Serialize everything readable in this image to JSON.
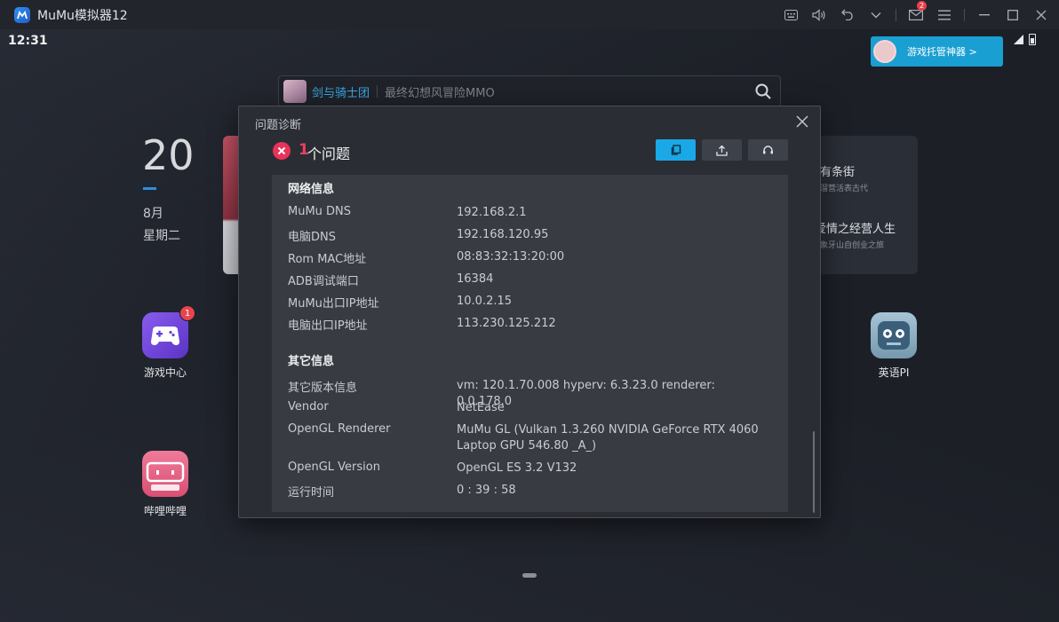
{
  "window": {
    "title": "MuMu模拟器12",
    "message_badge": "2"
  },
  "status": {
    "time": "12:31"
  },
  "promo": {
    "label": "游戏托管神器 >"
  },
  "search": {
    "app_name": "剑与骑士团",
    "hint": "最终幻想风冒险MMO"
  },
  "clock": {
    "day": "20",
    "month": "8月",
    "weekday": "星期二"
  },
  "widget": {
    "title1": "有条街",
    "sub1": "溜营活表古代",
    "title2": "爱情之经营人生",
    "sub2": "象牙山自创业之旅"
  },
  "apps": [
    {
      "label": "游戏中心",
      "badge": "1"
    },
    {
      "label": "哔哩哔哩"
    },
    {
      "label": "英语PI"
    }
  ],
  "dialog": {
    "title": "问题诊断",
    "issue_count": "1",
    "issue_text": "个问题",
    "sections": [
      {
        "title": "网络信息",
        "rows": [
          {
            "key": "MuMu DNS",
            "value": "192.168.2.1"
          },
          {
            "key": "电脑DNS",
            "value": "192.168.120.95"
          },
          {
            "key": "Rom MAC地址",
            "value": "08:83:32:13:20:00"
          },
          {
            "key": "ADB调试端口",
            "value": "16384"
          },
          {
            "key": "MuMu出口IP地址",
            "value": "10.0.2.15"
          },
          {
            "key": "电脑出口IP地址",
            "value": "113.230.125.212"
          }
        ]
      },
      {
        "title": "其它信息",
        "rows": [
          {
            "key": "其它版本信息",
            "value": "vm: 120.1.70.008 hyperv: 6.3.23.0 renderer: 0.0.178.0"
          },
          {
            "key": "Vendor",
            "value": "NetEase"
          },
          {
            "key": "OpenGL Renderer",
            "value": "MuMu GL (Vulkan 1.3.260 NVIDIA GeForce RTX 4060 Laptop GPU 546.80 _A_)"
          },
          {
            "key": "OpenGL Version",
            "value": "OpenGL ES 3.2 V132"
          },
          {
            "key": "运行时间",
            "value": "0 : 39 : 58"
          }
        ]
      }
    ]
  }
}
